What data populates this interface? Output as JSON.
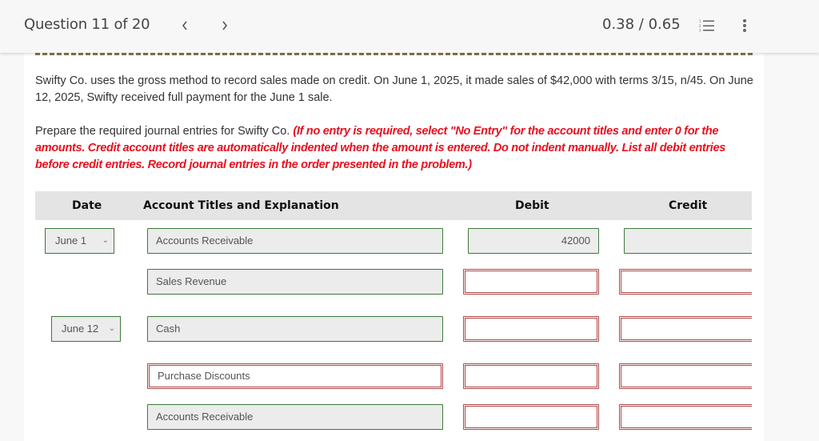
{
  "header": {
    "question_label": "Question 11 of 20",
    "prev_label": "<",
    "next_label": ">",
    "score": "0.38 / 0.65",
    "list_icon": "numbered-list-icon",
    "more_icon": "more-vertical-icon"
  },
  "problem": {
    "text": "Swifty Co. uses the gross method to record sales made on credit. On June 1, 2025, it made sales of $42,000 with terms 3/15, n/45. On June 12, 2025, Swifty received full payment for the June 1 sale.",
    "instruction_lead": "Prepare the required journal entries for Swifty Co. ",
    "instruction_note": "(If no entry is required, select \"No Entry\" for the account titles and enter 0 for the amounts. Credit account titles are automatically indented when the amount is entered. Do not indent manually. List all debit entries before credit entries. Record journal entries in the order presented in the problem.)"
  },
  "table": {
    "headers": {
      "date": "Date",
      "account": "Account Titles and Explanation",
      "debit": "Debit",
      "credit": "Credit"
    },
    "rows": [
      {
        "date": "June 1",
        "account": "Accounts Receivable",
        "account_status": "correct",
        "debit": "42000",
        "debit_status": "correct",
        "credit": "",
        "credit_status": "correct"
      },
      {
        "date": "",
        "account": "Sales Revenue",
        "account_status": "correct",
        "debit": "",
        "debit_status": "incorrect",
        "credit": "",
        "credit_status": "incorrect"
      },
      {
        "date": "June 12",
        "account": "Cash",
        "account_status": "correct",
        "debit": "",
        "debit_status": "incorrect",
        "credit": "",
        "credit_status": "incorrect"
      },
      {
        "date": "",
        "account": "Purchase Discounts",
        "account_status": "incorrect",
        "debit": "",
        "debit_status": "incorrect",
        "credit": "",
        "credit_status": "incorrect"
      },
      {
        "date": "",
        "account": "Accounts Receivable",
        "account_status": "correct",
        "debit": "",
        "debit_status": "incorrect",
        "credit": "",
        "credit_status": "incorrect"
      }
    ]
  },
  "colors": {
    "correct_border": "#3d7a3d",
    "incorrect_border": "#b04545",
    "instruction_red": "#e8101e",
    "dash_line": "#8a7448"
  }
}
